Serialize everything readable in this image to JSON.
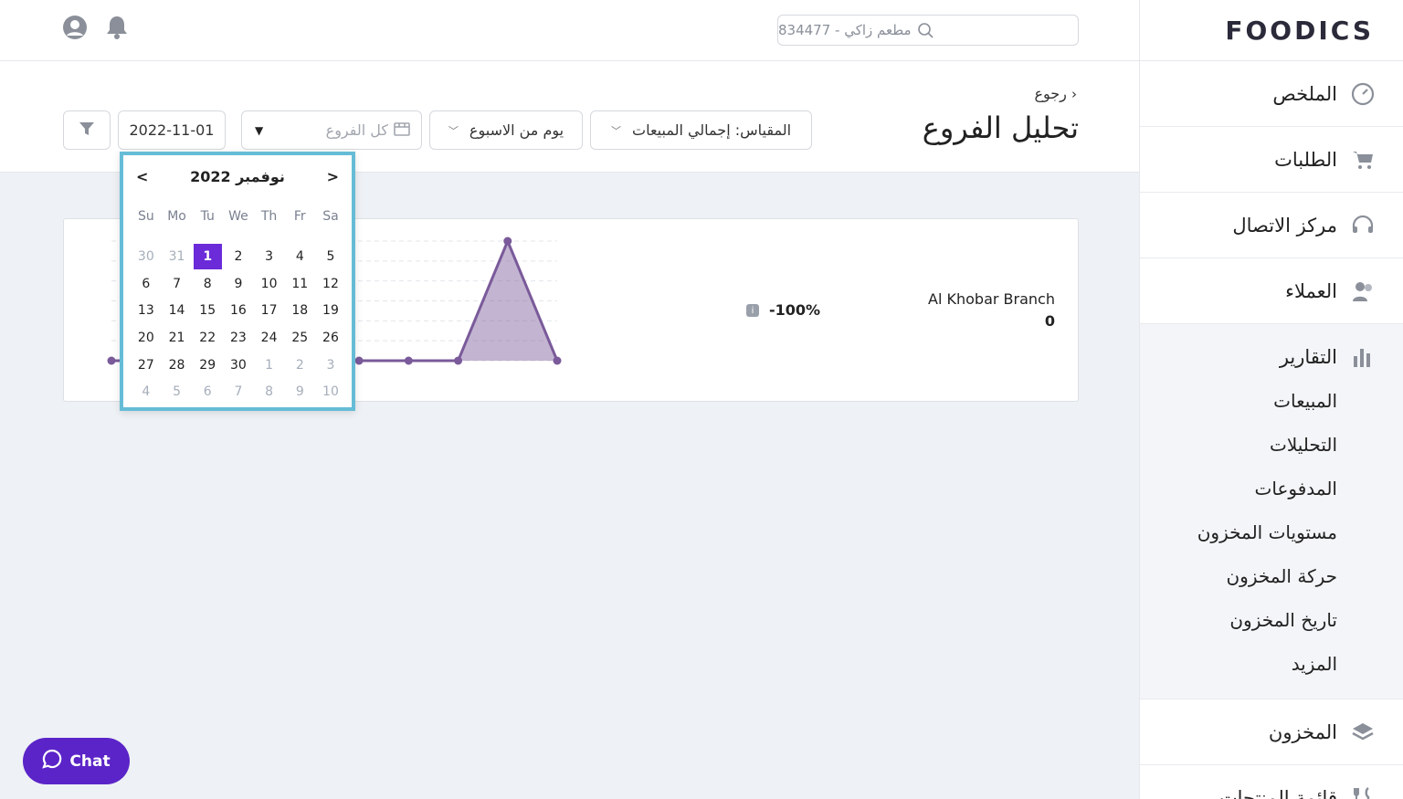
{
  "app": {
    "logo": "FOODICS"
  },
  "topbar": {
    "search_value": "مطعم زاكي - 834477",
    "icons": [
      "user-circle-icon",
      "bell-icon",
      "search-icon"
    ]
  },
  "sidebar": {
    "items_top": [
      {
        "label": "الملخص",
        "icon": "gauge-icon"
      },
      {
        "label": "الطلبات",
        "icon": "cart-icon"
      },
      {
        "label": "مركز الاتصال",
        "icon": "headset-icon"
      },
      {
        "label": "العملاء",
        "icon": "customers-icon"
      }
    ],
    "reports": {
      "label": "التقارير",
      "icon": "bar-chart-icon",
      "sub_items": [
        "المبيعات",
        "التحليلات",
        "المدفوعات",
        "مستويات المخزون",
        "حركة المخزون",
        "تاريخ المخزون",
        "المزيد"
      ]
    },
    "items_bottom": [
      {
        "label": "المخزون",
        "icon": "layers-icon"
      },
      {
        "label": "قائمة المنتجات",
        "icon": "fork-knife-icon"
      }
    ]
  },
  "header": {
    "back_label": "رجوع",
    "title": "تحليل الفروع",
    "metric_label": "المقياس: إجمالي المبيعات",
    "day_label": "يوم من الاسبوع",
    "branch_placeholder": "كل الفروع",
    "date_value": "2022-11-01"
  },
  "card": {
    "branch_name": "Al Khobar Branch",
    "branch_value": "0",
    "percent_change": "-100%"
  },
  "calendar": {
    "title": "نوفمبر 2022",
    "prev": "<",
    "next": ">",
    "weekdays": [
      "Su",
      "Mo",
      "Tu",
      "We",
      "Th",
      "Fr",
      "Sa"
    ],
    "weeks": [
      [
        {
          "d": "30",
          "m": 1
        },
        {
          "d": "31",
          "m": 1
        },
        {
          "d": "1",
          "s": 1
        },
        {
          "d": "2"
        },
        {
          "d": "3"
        },
        {
          "d": "4"
        },
        {
          "d": "5"
        }
      ],
      [
        {
          "d": "6"
        },
        {
          "d": "7"
        },
        {
          "d": "8"
        },
        {
          "d": "9"
        },
        {
          "d": "10"
        },
        {
          "d": "11"
        },
        {
          "d": "12"
        }
      ],
      [
        {
          "d": "13"
        },
        {
          "d": "14"
        },
        {
          "d": "15"
        },
        {
          "d": "16"
        },
        {
          "d": "17"
        },
        {
          "d": "18"
        },
        {
          "d": "19"
        }
      ],
      [
        {
          "d": "20"
        },
        {
          "d": "21"
        },
        {
          "d": "22"
        },
        {
          "d": "23"
        },
        {
          "d": "24"
        },
        {
          "d": "25"
        },
        {
          "d": "26"
        }
      ],
      [
        {
          "d": "27"
        },
        {
          "d": "28"
        },
        {
          "d": "29"
        },
        {
          "d": "30"
        },
        {
          "d": "1",
          "m": 1
        },
        {
          "d": "2",
          "m": 1
        },
        {
          "d": "3",
          "m": 1
        }
      ],
      [
        {
          "d": "4",
          "m": 1
        },
        {
          "d": "5",
          "m": 1
        },
        {
          "d": "6",
          "m": 1
        },
        {
          "d": "7",
          "m": 1
        },
        {
          "d": "8",
          "m": 1
        },
        {
          "d": "9",
          "m": 1
        },
        {
          "d": "10",
          "m": 1
        }
      ]
    ]
  },
  "chart_data": {
    "type": "area",
    "series": [
      {
        "values": [
          0,
          0,
          0,
          0,
          0,
          0,
          0,
          0,
          1,
          0
        ]
      }
    ],
    "color": "#7a5a9a"
  },
  "chat": {
    "label": "Chat"
  },
  "colors": {
    "accent": "#5b24c8",
    "selected_day": "#6b2bd9",
    "highlight_border": "#66bcd6"
  }
}
